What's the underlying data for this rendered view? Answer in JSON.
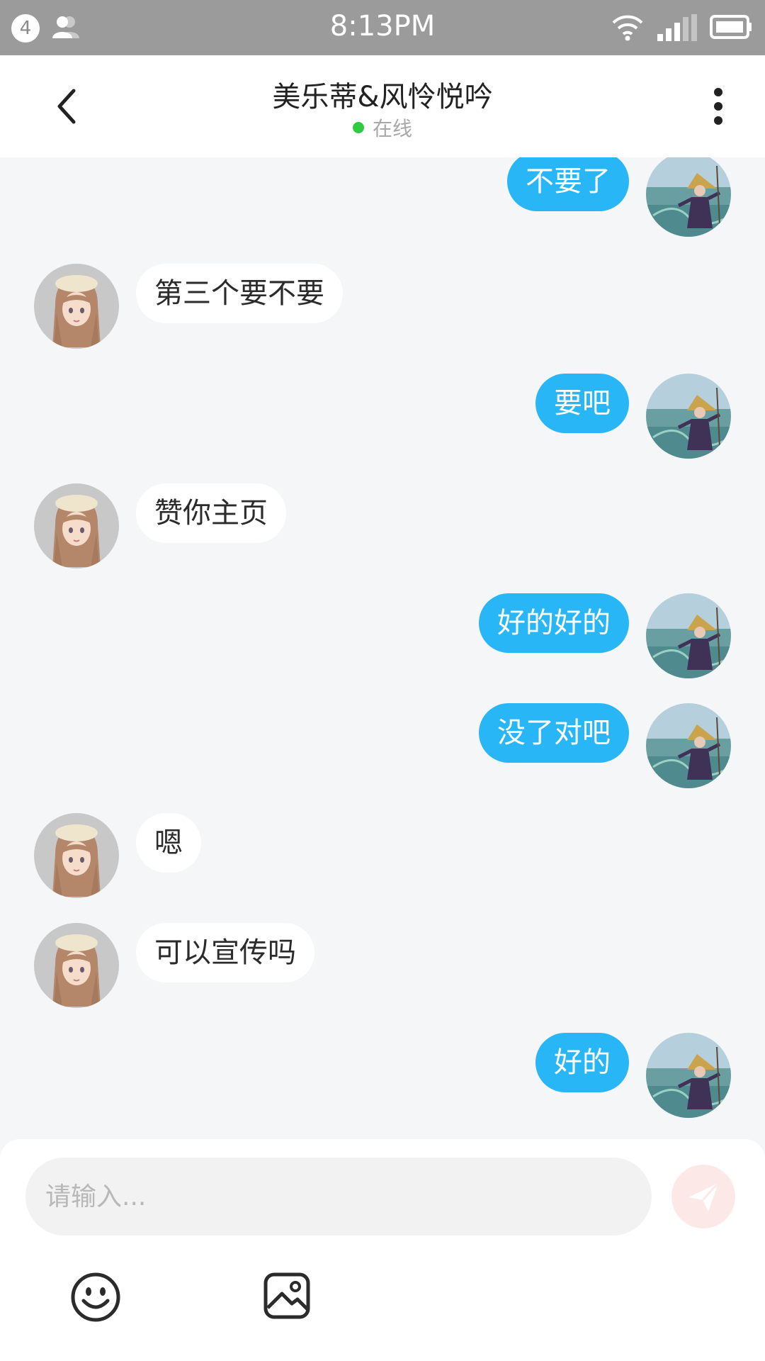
{
  "status_bar": {
    "notification_count": "4",
    "time": "8:13PM"
  },
  "header": {
    "title": "美乐蒂&风怜悦吟",
    "status": "在线"
  },
  "messages": [
    {
      "sender": "me",
      "text": "不要了"
    },
    {
      "sender": "them",
      "text": "第三个要不要"
    },
    {
      "sender": "me",
      "text": "要吧"
    },
    {
      "sender": "them",
      "text": "赞你主页"
    },
    {
      "sender": "me",
      "text": "好的好的"
    },
    {
      "sender": "me",
      "text": "没了对吧"
    },
    {
      "sender": "them",
      "text": "嗯"
    },
    {
      "sender": "them",
      "text": "可以宣传吗"
    },
    {
      "sender": "me",
      "text": "好的"
    }
  ],
  "input": {
    "placeholder": "请输入..."
  },
  "colors": {
    "status_bar": "#9b9b9b",
    "my_bubble": "#29b6f6",
    "their_bubble": "#ffffff",
    "online_dot": "#2ecc40",
    "send_button": "#fde8e8"
  },
  "icons": {
    "back": "chevron-left-icon",
    "more": "vertical-dots-icon",
    "send": "paper-plane-icon",
    "emoji": "smiley-icon",
    "image": "image-icon"
  }
}
